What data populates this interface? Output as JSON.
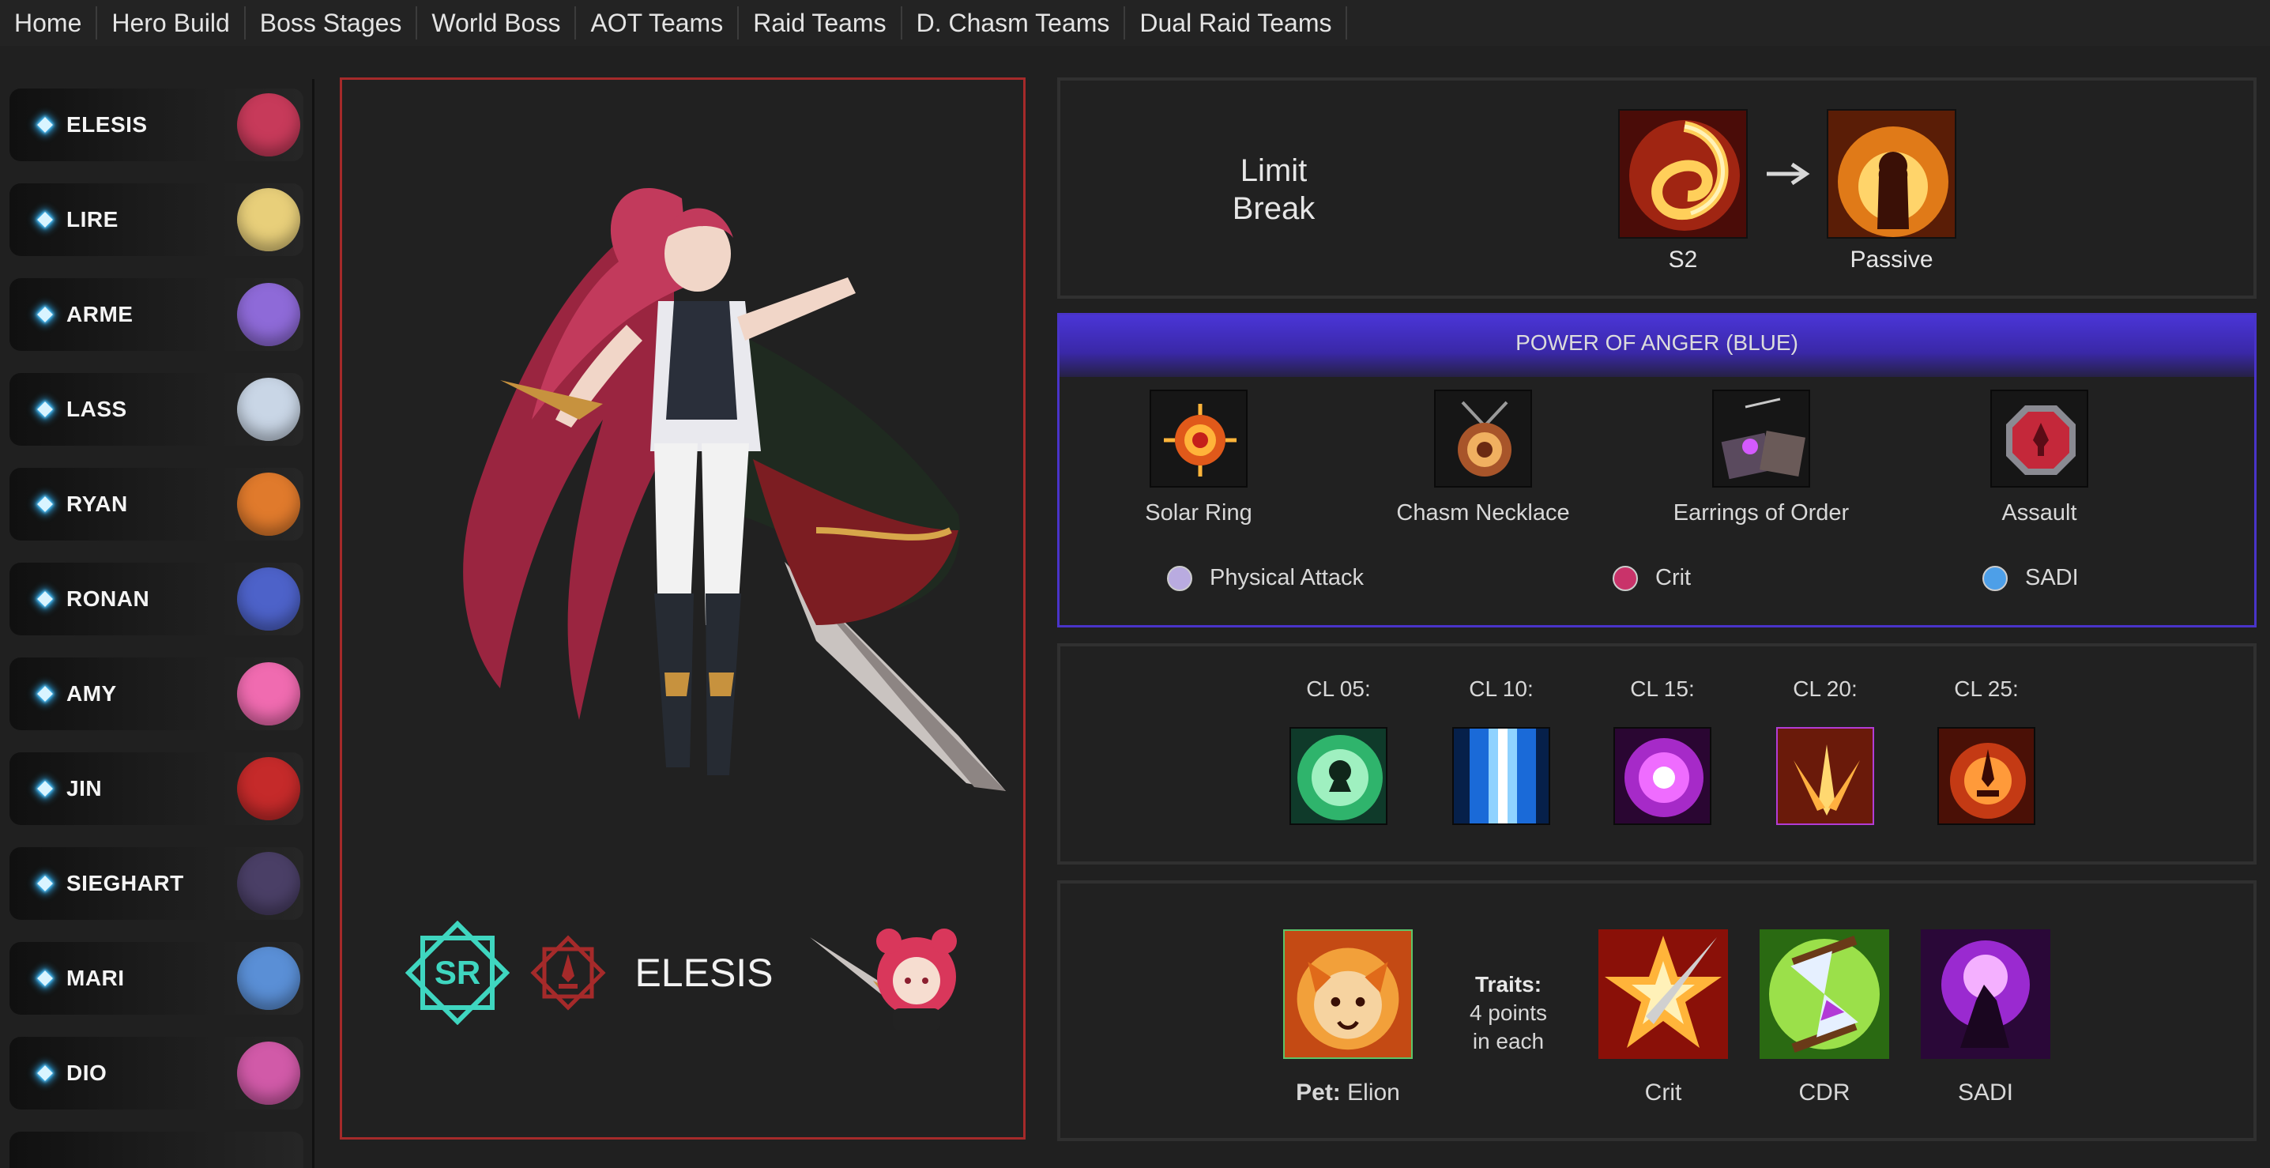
{
  "nav": {
    "tabs": [
      "Home",
      "Hero Build",
      "Boss Stages",
      "World Boss",
      "AOT Teams",
      "Raid Teams",
      "D. Chasm Teams",
      "Dual Raid Teams"
    ]
  },
  "sidebar": {
    "heroes": [
      {
        "name": "ELESIS",
        "color": "#c73a5a"
      },
      {
        "name": "LIRE",
        "color": "#e8cf7a"
      },
      {
        "name": "ARME",
        "color": "#8e6ad8"
      },
      {
        "name": "LASS",
        "color": "#c9d6e6"
      },
      {
        "name": "RYAN",
        "color": "#e07a2c"
      },
      {
        "name": "RONAN",
        "color": "#4d62c9"
      },
      {
        "name": "AMY",
        "color": "#f06bb0"
      },
      {
        "name": "JIN",
        "color": "#c52a2a"
      },
      {
        "name": "SIEGHART",
        "color": "#4a3f66"
      },
      {
        "name": "MARI",
        "color": "#5a8fd6"
      },
      {
        "name": "DIO",
        "color": "#d15aa8"
      }
    ]
  },
  "hero": {
    "name": "ELESIS",
    "rank": "SR",
    "accent": "#a52a2a"
  },
  "limit_break": {
    "title_line1": "Limit",
    "title_line2": "Break",
    "from_label": "S2",
    "to_label": "Passive"
  },
  "gear": {
    "header": "POWER OF ANGER (BLUE)",
    "items": [
      {
        "label": "Solar Ring",
        "icon": "solar-ring-icon"
      },
      {
        "label": "Chasm Necklace",
        "icon": "chasm-necklace-icon"
      },
      {
        "label": "Earrings of Order",
        "icon": "earrings-icon"
      },
      {
        "label": "Assault",
        "icon": "assault-icon"
      }
    ],
    "stats": [
      {
        "label": "Physical Attack",
        "color": "#b9abe0"
      },
      {
        "label": "Crit",
        "color": "#c9336a"
      },
      {
        "label": "SADI",
        "color": "#4d9fe8"
      }
    ]
  },
  "chaser": {
    "levels": [
      "CL 05:",
      "CL 10:",
      "CL 15:",
      "CL 20:",
      "CL 25:"
    ]
  },
  "pet": {
    "prefix": "Pet:",
    "name": "Elion",
    "traits_title": "Traits:",
    "traits_line1": "4 points",
    "traits_line2": "in each",
    "trait_items": [
      "Crit",
      "CDR",
      "SADI"
    ]
  }
}
